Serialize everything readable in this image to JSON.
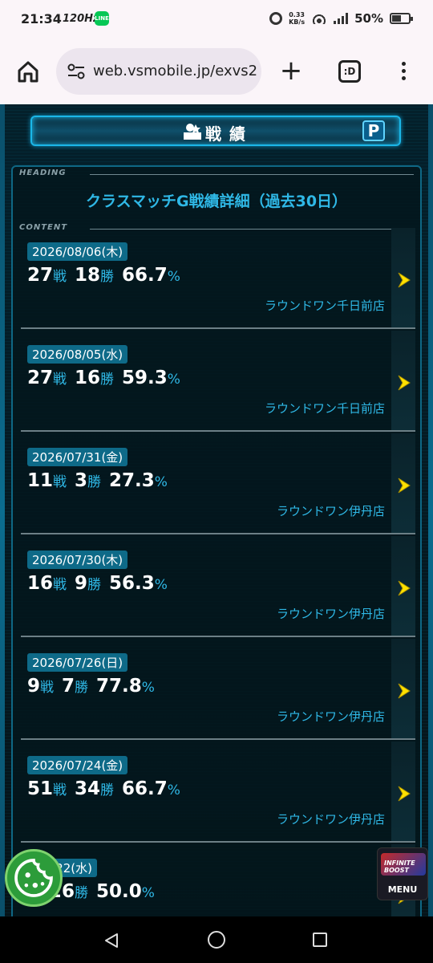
{
  "status_bar": {
    "time": "21:34",
    "refresh_rate": "120Hz",
    "line_app": "LINE",
    "speed_value": "0.33",
    "speed_unit": "KB/s",
    "battery": "50%"
  },
  "browser": {
    "url": "web.vsmobile.jp/exvs2",
    "tabs_label": ":D",
    "plus_label": "+"
  },
  "page": {
    "title": "戦績",
    "p_label": "P",
    "heading_tag": "HEADING",
    "content_tag": "CONTENT",
    "heading": "クラスマッチG戦績詳細（過去30日）",
    "battles_unit": "戦",
    "wins_unit": "勝",
    "rate_unit": "%",
    "records": [
      {
        "date": "2026/08/06(木)",
        "battles": "27",
        "wins": "18",
        "rate": "66.7",
        "shop": "ラウンドワン千日前店"
      },
      {
        "date": "2026/08/05(水)",
        "battles": "27",
        "wins": "16",
        "rate": "59.3",
        "shop": "ラウンドワン千日前店"
      },
      {
        "date": "2026/07/31(金)",
        "battles": "11",
        "wins": "3",
        "rate": "27.3",
        "shop": "ラウンドワン伊丹店"
      },
      {
        "date": "2026/07/30(木)",
        "battles": "16",
        "wins": "9",
        "rate": "56.3",
        "shop": "ラウンドワン伊丹店"
      },
      {
        "date": "2026/07/26(日)",
        "battles": "9",
        "wins": "7",
        "rate": "77.8",
        "shop": "ラウンドワン伊丹店"
      },
      {
        "date": "2026/07/24(金)",
        "battles": "51",
        "wins": "34",
        "rate": "66.7",
        "shop": "ラウンドワン伊丹店"
      },
      {
        "date": "/07/22(水)",
        "battles": "",
        "wins": "26",
        "rate": "50.0",
        "shop": ""
      }
    ],
    "menu_label": "MENU",
    "menu_logo_text": "INFINITE BOOST"
  },
  "colors": {
    "accent": "#2fb8e6",
    "arrow": "#ffe100",
    "date_badge": "#0e6a88"
  }
}
